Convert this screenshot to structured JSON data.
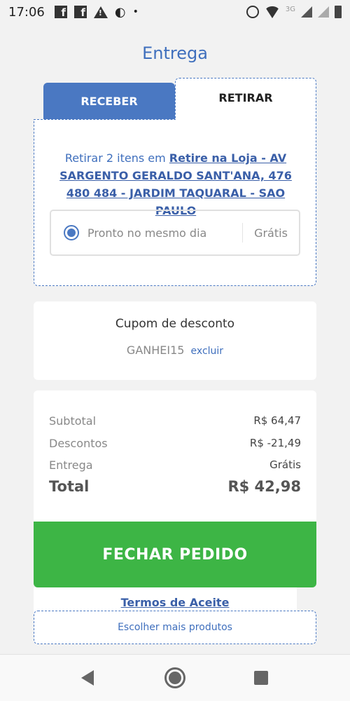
{
  "status_bar": {
    "time": "17:06",
    "network_label": "3G",
    "icons_left": [
      "facebook-icon",
      "facebook-icon",
      "warning-icon",
      "data-saver-icon",
      "dot-icon"
    ],
    "icons_right": [
      "alarm-icon",
      "wifi-icon",
      "signal-icon",
      "signal-icon",
      "battery-icon"
    ]
  },
  "page": {
    "title": "Entrega"
  },
  "tabs": {
    "receber": "RECEBER",
    "retirar": "RETIRAR",
    "active": "retirar"
  },
  "pickup": {
    "prefix": "Retirar 2 itens em ",
    "store": "Retire na Loja - AV SARGENTO GERALDO SANT'ANA, 476 480 484 - JARDIM TAQUARAL - SAO PAULO",
    "option_label": "Pronto no mesmo dia",
    "option_price": "Grátis",
    "option_selected": true
  },
  "coupon": {
    "title": "Cupom de desconto",
    "code": "GANHEI15",
    "remove_label": "excluir"
  },
  "summary": {
    "subtotal_label": "Subtotal",
    "subtotal_value": "R$ 64,47",
    "discount_label": "Descontos",
    "discount_value": "R$ -21,49",
    "shipping_label": "Entrega",
    "shipping_value": "Grátis",
    "total_label": "Total",
    "total_value": "R$ 42,98"
  },
  "actions": {
    "checkout_label": "FECHAR PEDIDO",
    "terms_label": "Termos de Aceite",
    "more_products_label": "Escolher mais produtos"
  },
  "colors": {
    "primary_blue": "#4a78c2",
    "link_blue": "#3f6fbd",
    "checkout_green": "#3db545",
    "background": "#f2f2f2"
  }
}
